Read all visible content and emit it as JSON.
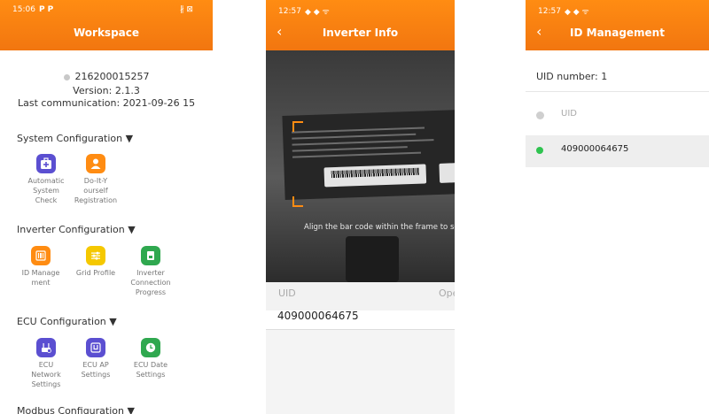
{
  "phone1": {
    "status_time": "15:06",
    "status_icons": "P P",
    "status_right": "∦ ⊠",
    "title": "Workspace",
    "ecu_id": "216200015257",
    "version": "Version: 2.1.3",
    "last_comm": "Last communication: 2021-09-26 15",
    "sections": {
      "system": "System Configuration ▼",
      "inverter": "Inverter Configuration ▼",
      "ecu": "ECU Configuration ▼",
      "modbus": "Modbus Configuration ▼"
    },
    "tiles": {
      "auto_check": [
        "Automatic",
        "System",
        "Check"
      ],
      "diy_reg": [
        "Do-It-Y",
        "ourself",
        "Registration"
      ],
      "id_mgmt": [
        "ID Manage",
        "ment"
      ],
      "grid_profile": [
        "Grid Profile"
      ],
      "inv_conn": [
        "Inverter",
        "Connection",
        "Progress"
      ],
      "ecu_net": [
        "ECU",
        "Network",
        "Settings"
      ],
      "ecu_ap": [
        "ECU AP",
        "Settings"
      ],
      "ecu_date": [
        "ECU Date",
        "Settings"
      ]
    },
    "colors": {
      "header": "#f57d10",
      "purple": "#5b4fd1",
      "orange": "#ff8c12",
      "yellow": "#f5c800",
      "green": "#2fa84f"
    }
  },
  "phone2": {
    "status_time": "12:57",
    "status_icons": "◆ ◆ ᯤ",
    "title": "Inverter Info",
    "back_icon": "‹",
    "hint": "Align the bar code within the frame to sca",
    "uid_label": "UID",
    "op_label": "Ope",
    "uid_value": "409000064675"
  },
  "phone3": {
    "status_time": "12:57",
    "status_icons": "◆ ◆ ᯤ",
    "title": "ID Management",
    "back_icon": "‹",
    "uid_number": "UID number: 1",
    "header_uid": "UID",
    "item_uid": "409000064675",
    "colors": {
      "online": "#2fc350",
      "offline": "#cfcfcf"
    }
  }
}
